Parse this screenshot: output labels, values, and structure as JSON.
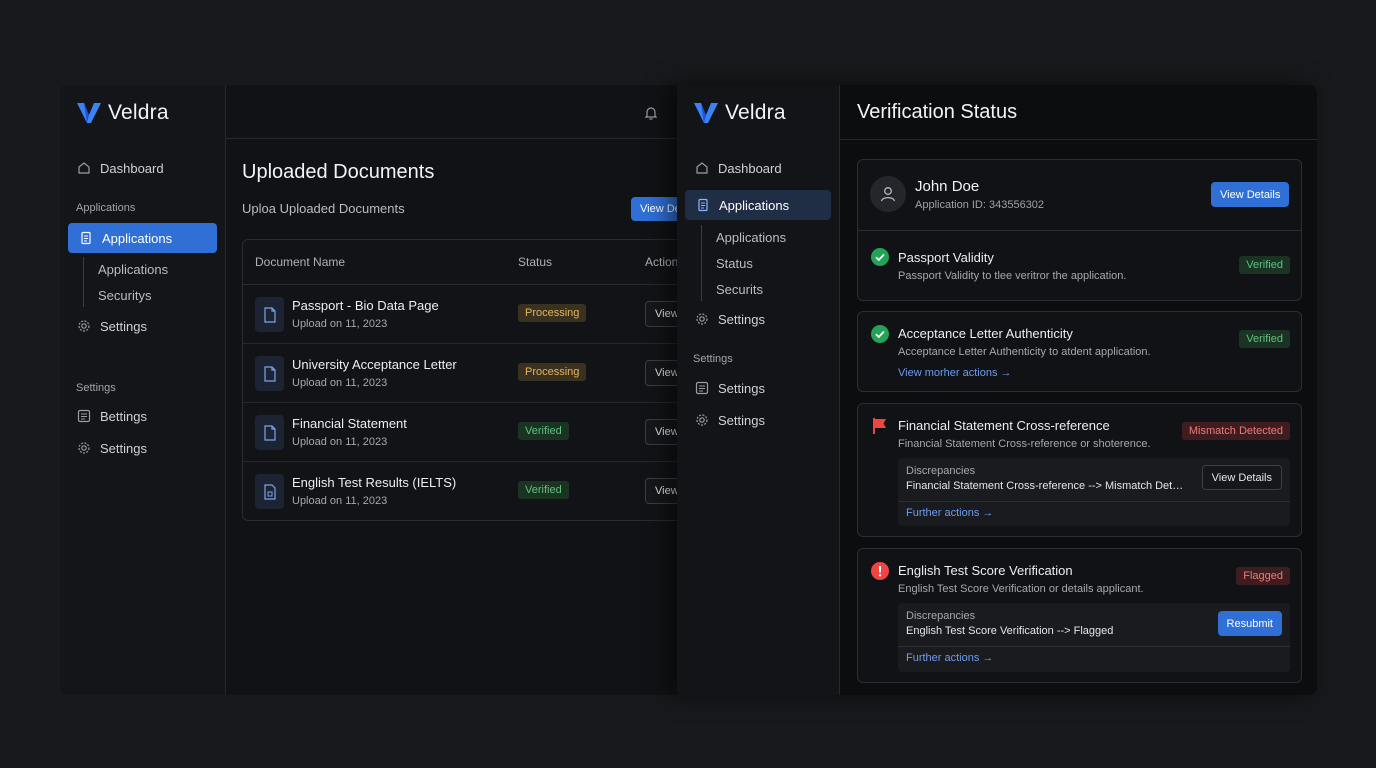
{
  "left_window": {
    "brand": "Veldra",
    "nav": {
      "dashboard": "Dashboard",
      "applications_section": "Applications",
      "applications": "Applications",
      "sub_items": [
        "Applications",
        "Securitys"
      ],
      "settings": "Settings",
      "settings_section": "Settings",
      "settings_items": [
        "Bettings",
        "Settings"
      ]
    },
    "main": {
      "title": "Uploaded Documents",
      "subtitle": "Uploa Uploaded Documents",
      "view_details": "View Details",
      "columns": {
        "name": "Document Name",
        "status": "Status",
        "actions": "Actions"
      },
      "rows": [
        {
          "name": "Passport - Bio Data Page",
          "date": "Upload on 11, 2023",
          "status": "Processing",
          "action": "View"
        },
        {
          "name": "University Acceptance Letter",
          "date": "Upload on 11, 2023",
          "status": "Processing",
          "action": "View"
        },
        {
          "name": "Financial Statement",
          "date": "Upload on 11, 2023",
          "status": "Verified",
          "action": "View"
        },
        {
          "name": "English Test Results (IELTS)",
          "date": "Upload on 11, 2023",
          "status": "Verified",
          "action": "View"
        }
      ]
    }
  },
  "right_window": {
    "brand": "Veldra",
    "nav": {
      "dashboard": "Dashboard",
      "applications": "Applications",
      "sub_items": [
        "Applications",
        "Status",
        "Securits"
      ],
      "settings": "Settings",
      "settings_section": "Settings",
      "settings_items": [
        "Settings",
        "Settings"
      ]
    },
    "title": "Verification Status",
    "applicant": {
      "name": "John Doe",
      "app_id": "Application ID: 343556302",
      "view_details": "View Details"
    },
    "checks": [
      {
        "title": "Passport Validity",
        "desc": "Passport Validity to tlee veritror the application.",
        "status": "Verified"
      },
      {
        "title": "Acceptance Letter Authenticity",
        "desc": "Acceptance Letter Authenticity to atdent application.",
        "status": "Verified",
        "link": "View morher actions →"
      },
      {
        "title": "Financial Statement Cross-reference",
        "desc": "Financial Statement Cross-reference or shoterence.",
        "status": "Mismatch Detected",
        "disc_label": "Discrepancies",
        "disc_text": "Financial Statement Cross-reference --> Mismatch Detected",
        "button": "View Details",
        "link": "Further actions →"
      },
      {
        "title": "English Test Score Verification",
        "desc": "English Test Score Verification or details applicant.",
        "status": "Flagged",
        "disc_label": "Discrepancies",
        "disc_text": "English Test Score Verification --> Flagged",
        "button": "Resubmit",
        "link": "Further actions →"
      }
    ]
  },
  "colors": {
    "accent": "#2f6fd6",
    "verified": "#5fc27e",
    "processing": "#e7b35c",
    "danger": "#ef4444"
  }
}
